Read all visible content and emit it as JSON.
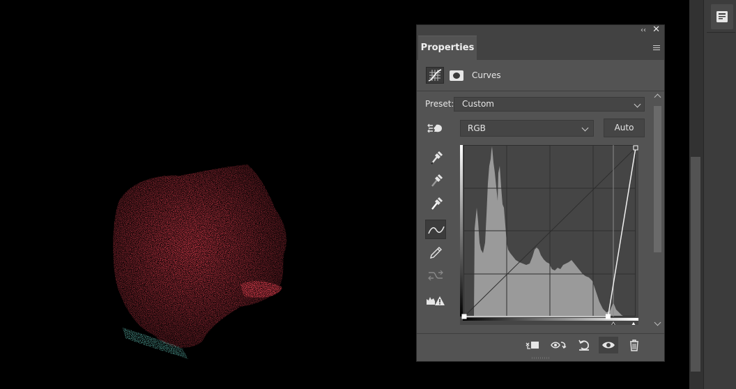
{
  "panel": {
    "collapse_glyph": "‹‹",
    "close_glyph": "✕",
    "tab_label": "Properties",
    "adjustment_title": "Curves",
    "preset_label": "Preset:",
    "preset_value": "Custom",
    "channel_value": "RGB",
    "auto_label": "Auto"
  },
  "icons": {
    "menu": "panel-menu-icon",
    "adjustment": "curves-adjustment-icon",
    "mask": "layer-mask-icon",
    "on_image": "on-image-adjustment-icon",
    "eyedropper_black": "eyedropper-black-icon",
    "eyedropper_gray": "eyedropper-gray-icon",
    "eyedropper_white": "eyedropper-white-icon",
    "curve_point": "curve-point-tool-icon",
    "pencil": "pencil-draw-icon",
    "smooth": "smooth-curve-icon",
    "clipping_warning": "clipping-warning-icon",
    "clip_to_layer": "clip-to-layer-icon",
    "view_previous": "view-previous-state-icon",
    "reset": "reset-icon",
    "visibility": "eye-icon",
    "delete": "trash-icon"
  },
  "curve": {
    "points": [
      [
        0,
        0
      ],
      [
        214,
        0
      ],
      [
        255,
        255
      ]
    ],
    "input_black": 214,
    "input_white": 255
  },
  "colors": {
    "panel_bg": "#535353",
    "histogram": "#9a9a9a",
    "canvas_red": "#b0141a",
    "canvas_cyan": "#1f8a7a"
  }
}
